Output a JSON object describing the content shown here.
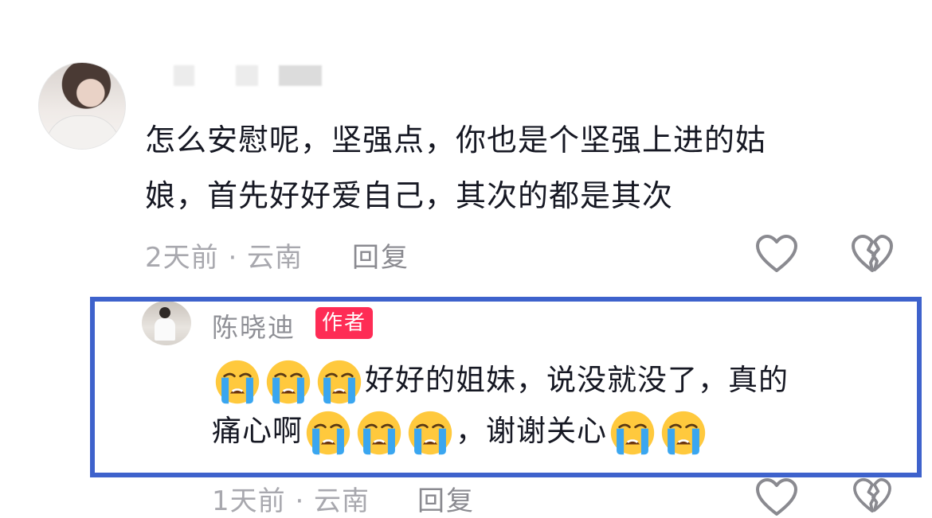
{
  "comment1": {
    "text_line1": "怎么安慰呢，坚强点，你也是个坚强上进的姑",
    "text_line2": "娘，首先好好爱自己，其次的都是其次",
    "meta": "2天前 · 云南",
    "reply_label": "回复"
  },
  "comment2": {
    "author": "陈晓迪",
    "badge": "作者",
    "line1_text": "好好的姐妹，说没就没了，真的",
    "line2_text_a": "痛心啊",
    "line2_text_b": "，谢谢关心",
    "meta": "1天前 · 云南",
    "reply_label": "回复"
  },
  "icons": [
    "heart-outline-icon",
    "broken-heart-icon",
    "crying-face-emoji"
  ],
  "colors": {
    "highlight": "#3e62cc",
    "badge": "#fe2c55",
    "meta": "#a8a8ae"
  }
}
